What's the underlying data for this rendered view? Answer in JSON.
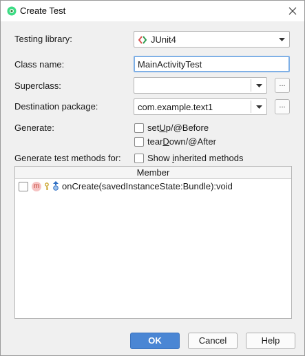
{
  "window": {
    "title": "Create Test"
  },
  "form": {
    "testing_library_label": "Testing library:",
    "testing_library_value": "JUnit4",
    "class_name_label": "Class name:",
    "class_name_value": "MainActivityTest",
    "superclass_label": "Superclass:",
    "superclass_value": "",
    "destination_package_label": "Destination package:",
    "destination_package_value": "com.example.text1",
    "browse_label": "...",
    "generate_label": "Generate:",
    "setup_label_pre": "set",
    "setup_label_u": "U",
    "setup_label_post": "p/@Before",
    "teardown_label_pre": "tear",
    "teardown_label_u": "D",
    "teardown_label_post": "own/@After",
    "generate_methods_label": "Generate test methods for:",
    "show_inherited_pre": "Show ",
    "show_inherited_u": "i",
    "show_inherited_post": "nherited methods"
  },
  "table": {
    "header": "Member",
    "rows": [
      {
        "badge": "m",
        "signature": "onCreate(savedInstanceState:Bundle):void"
      }
    ]
  },
  "buttons": {
    "ok": "OK",
    "cancel": "Cancel",
    "help": "Help"
  },
  "colors": {
    "accent": "#4a86d4",
    "badge_bg": "#f6c3c3",
    "badge_fg": "#c0392b"
  }
}
